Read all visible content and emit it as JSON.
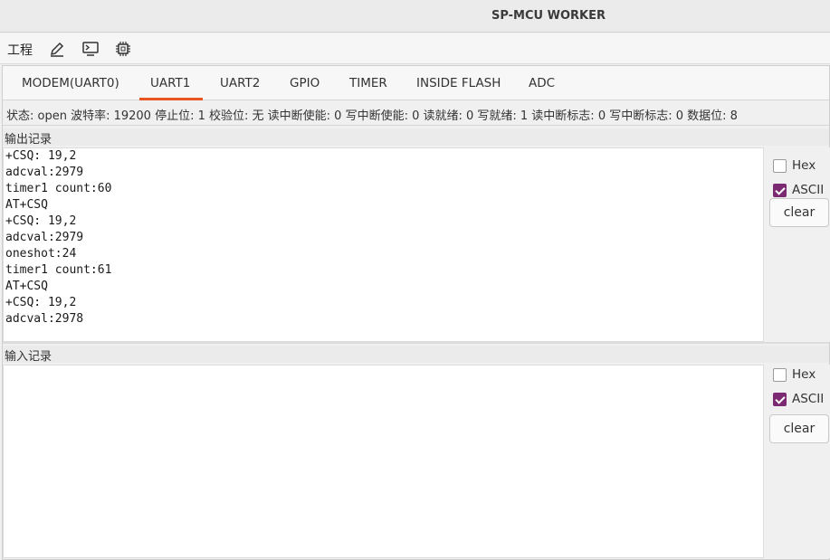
{
  "window": {
    "title": "SP-MCU WORKER"
  },
  "toolbar": {
    "menu_project": "工程",
    "icons": [
      "pencil-icon",
      "terminal-icon",
      "chip-icon"
    ]
  },
  "tabs": [
    {
      "label": "MODEM(UART0)",
      "active": false
    },
    {
      "label": "UART1",
      "active": true
    },
    {
      "label": "UART2",
      "active": false
    },
    {
      "label": "GPIO",
      "active": false
    },
    {
      "label": "TIMER",
      "active": false
    },
    {
      "label": "INSIDE FLASH",
      "active": false
    },
    {
      "label": "ADC",
      "active": false
    }
  ],
  "status_line": "状态: open 波特率: 19200 停止位: 1 校验位: 无 读中断使能: 0 写中断使能: 0 读就绪: 0 写就绪: 1 读中断标志: 0 写中断标志: 0 数据位: 8",
  "output": {
    "label": "输出记录",
    "lines": [
      "+CSQ: 19,2",
      "adcval:2979",
      "timer1 count:60",
      "AT+CSQ",
      "+CSQ: 19,2",
      "adcval:2979",
      "oneshot:24",
      "timer1 count:61",
      "AT+CSQ",
      "+CSQ: 19,2",
      "adcval:2978"
    ],
    "hex_label": "Hex",
    "hex_checked": false,
    "ascii_label": "ASCII",
    "ascii_checked": true,
    "clear_label": "clear"
  },
  "input": {
    "label": "输入记录",
    "lines": [],
    "hex_label": "Hex",
    "hex_checked": false,
    "ascii_label": "ASCII",
    "ascii_checked": true,
    "clear_label": "clear"
  },
  "colors": {
    "accent": "#e95420",
    "checkbox": "#7b2a72"
  }
}
